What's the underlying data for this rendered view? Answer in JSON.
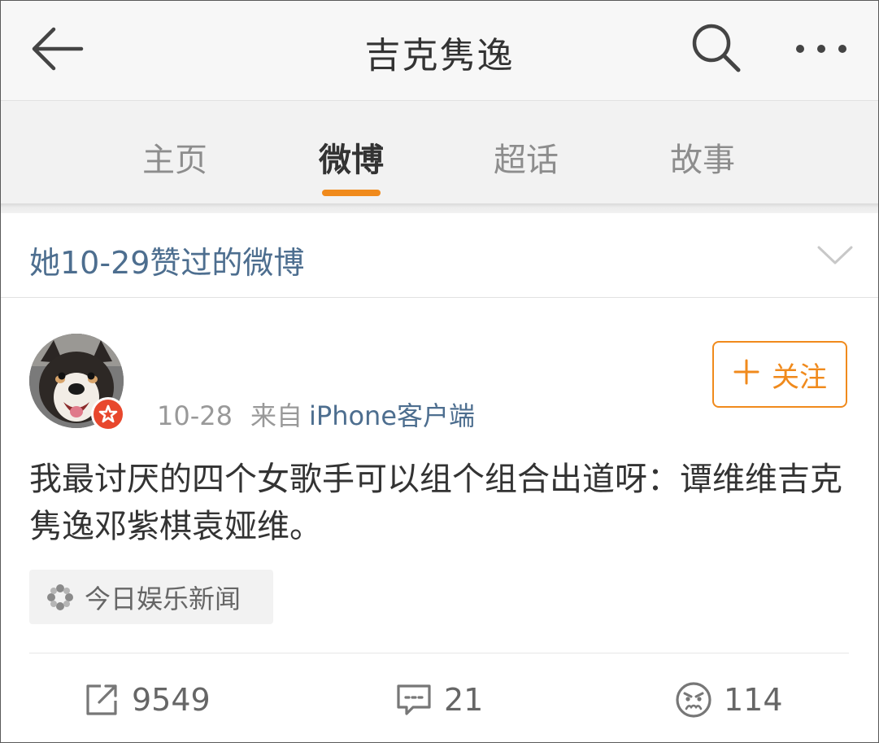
{
  "header": {
    "title": "吉克隽逸",
    "back_icon": "arrow-left-icon",
    "search_icon": "search-icon",
    "more_icon": "more-dots-icon"
  },
  "tabs": [
    {
      "label": "主页",
      "active": false
    },
    {
      "label": "微博",
      "active": true
    },
    {
      "label": "超话",
      "active": false
    },
    {
      "label": "故事",
      "active": false
    }
  ],
  "liked_banner": {
    "text": "她10-29赞过的微博",
    "icon": "chevron-down-icon"
  },
  "post": {
    "avatar_icon": "dog-avatar",
    "badge_icon": "verified-star-icon",
    "time": "10-28",
    "source_label": "来自",
    "source": "iPhone客户端",
    "follow_label": "关注",
    "text": "我最讨厌的四个女歌手可以组个组合出道呀：谭维维吉克隽逸邓紫棋袁娅维。",
    "topic": "今日娱乐新闻",
    "reposts": "9549",
    "comments": "21",
    "reactions": "114"
  },
  "colors": {
    "accent": "#f08a1c",
    "link": "#4d6e8f",
    "badge": "#e8472d"
  }
}
